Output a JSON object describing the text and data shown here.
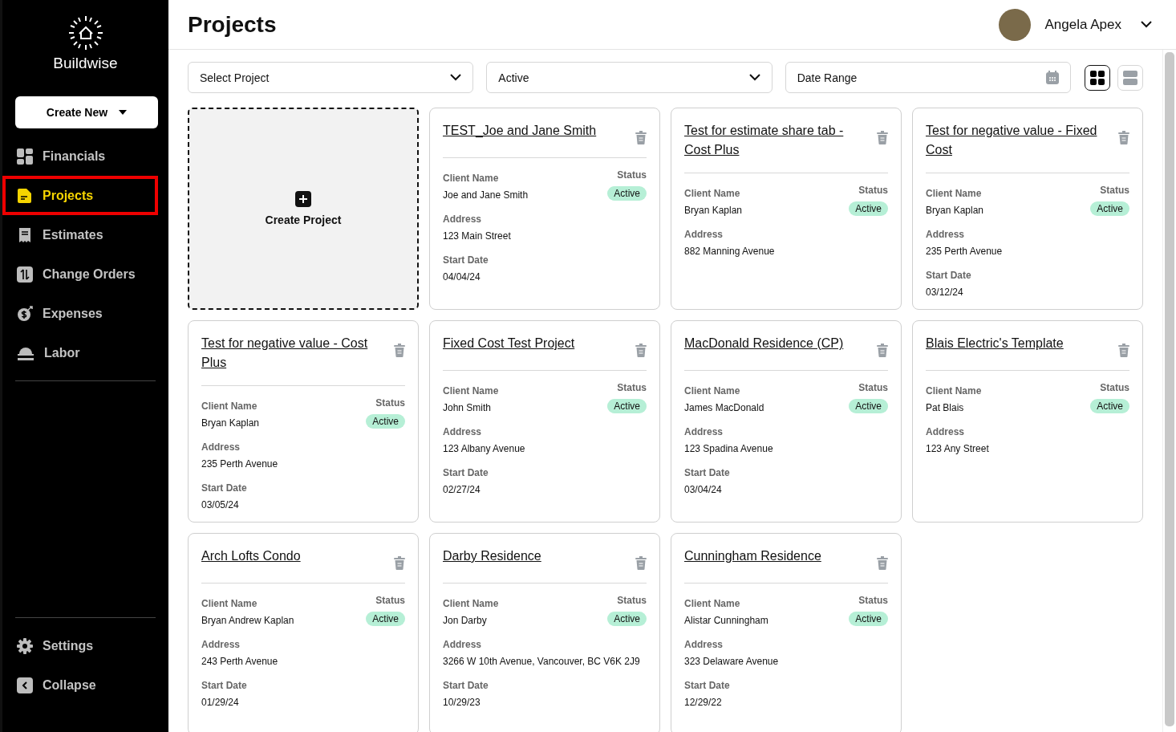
{
  "brand": {
    "name": "Buildwise"
  },
  "create_new": {
    "label": "Create New"
  },
  "nav": [
    {
      "kind": "financials",
      "label": "Financials",
      "selected": false,
      "highlighted": false
    },
    {
      "kind": "projects",
      "label": "Projects",
      "selected": true,
      "highlighted": true
    },
    {
      "kind": "estimates",
      "label": "Estimates",
      "selected": false,
      "highlighted": false
    },
    {
      "kind": "change-orders",
      "label": "Change Orders",
      "selected": false,
      "highlighted": false
    },
    {
      "kind": "expenses",
      "label": "Expenses",
      "selected": false,
      "highlighted": false
    },
    {
      "kind": "labor",
      "label": "Labor",
      "selected": false,
      "highlighted": false
    }
  ],
  "nav_bottom": [
    {
      "kind": "settings",
      "label": "Settings"
    },
    {
      "kind": "collapse",
      "label": "Collapse"
    }
  ],
  "page_title": "Projects",
  "user": {
    "name": "Angela Apex"
  },
  "filters": [
    {
      "kind": "select",
      "value": "Select Project"
    },
    {
      "kind": "select",
      "value": "Active"
    },
    {
      "kind": "date",
      "placeholder": "Date Range"
    }
  ],
  "view_toggle": [
    {
      "kind": "grid",
      "selected": true
    },
    {
      "kind": "list",
      "selected": false
    }
  ],
  "create_tile": {
    "label": "Create Project"
  },
  "projects": [
    {
      "title": "TEST_Joe and Jane Smith",
      "client_label": "Client Name",
      "client": "Joe and Jane Smith",
      "status_label": "Status",
      "status": "Active",
      "address_label": "Address",
      "address": "123 Main Street",
      "start_label": "Start Date",
      "start": "04/04/24"
    },
    {
      "title": "Test for estimate share tab - Cost Plus",
      "client_label": "Client Name",
      "client": "Bryan Kaplan",
      "status_label": "Status",
      "status": "Active",
      "address_label": "Address",
      "address": "882 Manning Avenue"
    },
    {
      "title": "Test for negative value - Fixed Cost",
      "client_label": "Client Name",
      "client": "Bryan Kaplan",
      "status_label": "Status",
      "status": "Active",
      "address_label": "Address",
      "address": "235 Perth Avenue",
      "start_label": "Start Date",
      "start": "03/12/24"
    },
    {
      "title": "Test for negative value - Cost Plus",
      "client_label": "Client Name",
      "client": "Bryan Kaplan",
      "status_label": "Status",
      "status": "Active",
      "address_label": "Address",
      "address": "235 Perth Avenue",
      "start_label": "Start Date",
      "start": "03/05/24"
    },
    {
      "title": "Fixed Cost Test Project",
      "client_label": "Client Name",
      "client": "John Smith",
      "status_label": "Status",
      "status": "Active",
      "address_label": "Address",
      "address": "123 Albany Avenue",
      "start_label": "Start Date",
      "start": "02/27/24"
    },
    {
      "title": "MacDonald Residence (CP)",
      "client_label": "Client Name",
      "client": "James MacDonald",
      "status_label": "Status",
      "status": "Active",
      "address_label": "Address",
      "address": "123 Spadina Avenue",
      "start_label": "Start Date",
      "start": "03/04/24"
    },
    {
      "title": "Blais Electric's Template",
      "client_label": "Client Name",
      "client": "Pat Blais",
      "status_label": "Status",
      "status": "Active",
      "address_label": "Address",
      "address": "123 Any Street"
    },
    {
      "title": "Arch Lofts Condo",
      "client_label": "Client Name",
      "client": "Bryan Andrew Kaplan",
      "status_label": "Status",
      "status": "Active",
      "address_label": "Address",
      "address": "243 Perth Avenue",
      "start_label": "Start Date",
      "start": "01/29/24"
    },
    {
      "title": "Darby Residence",
      "client_label": "Client Name",
      "client": "Jon Darby",
      "status_label": "Status",
      "status": "Active",
      "address_label": "Address",
      "address": "3266 W 10th Avenue, Vancouver, BC V6K 2J9",
      "start_label": "Start Date",
      "start": "10/29/23"
    },
    {
      "title": "Cunningham Residence",
      "client_label": "Client Name",
      "client": "Alistar Cunningham",
      "status_label": "Status",
      "status": "Active",
      "address_label": "Address",
      "address": "323 Delaware Avenue",
      "start_label": "Start Date",
      "start": "12/29/22"
    }
  ]
}
